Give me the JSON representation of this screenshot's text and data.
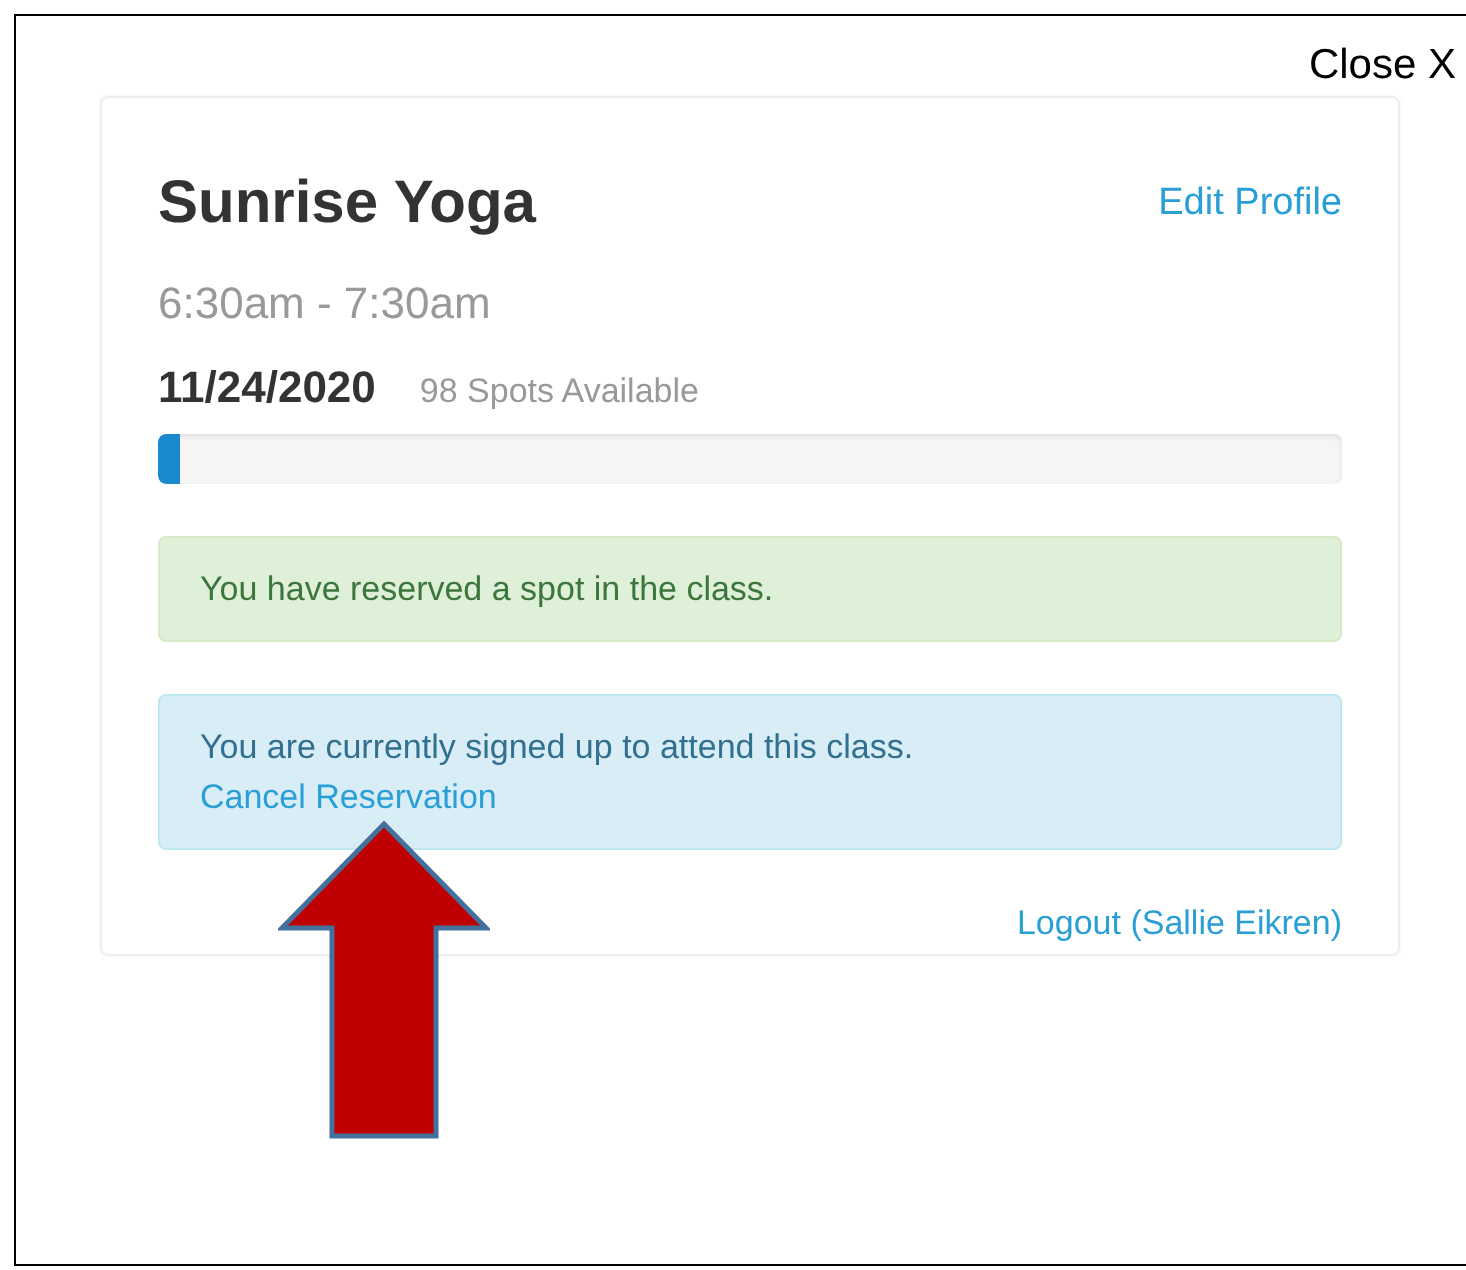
{
  "close_button": "Close X",
  "card": {
    "title": "Sunrise Yoga",
    "edit_link": "Edit Profile",
    "time": "6:30am - 7:30am",
    "date": "11/24/2020",
    "spots": "98 Spots Available",
    "capacity": {
      "level": 0.018
    },
    "alerts": [
      {
        "kind": "success",
        "text": "You have reserved a spot in the class."
      },
      {
        "kind": "info",
        "text": "You are currently signed up to attend this class.",
        "link": "Cancel Reservation"
      }
    ],
    "logout_link": "Logout (Sallie Eikren)"
  }
}
